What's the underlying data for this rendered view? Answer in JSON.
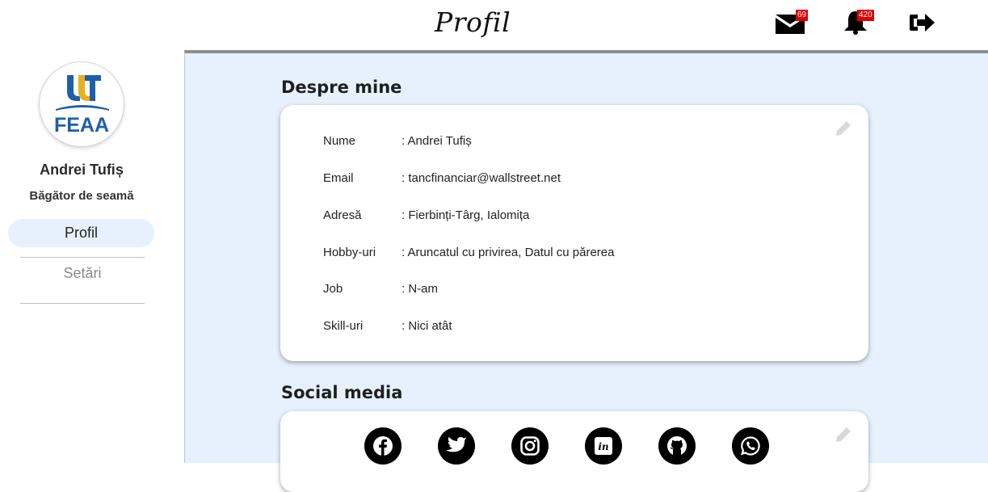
{
  "header": {
    "title": "Profil",
    "messages_count": "69",
    "notifications_count": "420",
    "icons": [
      "envelope-icon",
      "bell-icon",
      "logout-icon"
    ]
  },
  "sidebar": {
    "logo_text": "FEAA",
    "user_name": "Andrei Tufiș",
    "user_role": "Băgător de seamă",
    "nav": [
      {
        "label": "Profil",
        "active": true
      },
      {
        "label": "Setări",
        "active": false
      }
    ]
  },
  "about": {
    "title": "Despre mine",
    "rows": [
      {
        "label": "Nume",
        "value": ": Andrei Tufiș"
      },
      {
        "label": "Email",
        "value": ": tancfinanciar@wallstreet.net"
      },
      {
        "label": "Adresă",
        "value": ": Fierbinți-Târg, Ialomița"
      },
      {
        "label": "Hobby-uri",
        "value": ": Aruncatul cu privirea, Datul cu părerea"
      },
      {
        "label": "Job",
        "value": ": N-am"
      },
      {
        "label": "Skill-uri",
        "value": ": Nici atât"
      }
    ]
  },
  "social": {
    "title": "Social media",
    "networks": [
      "facebook-icon",
      "twitter-icon",
      "instagram-icon",
      "linkedin-icon",
      "github-icon",
      "whatsapp-icon"
    ]
  },
  "colors": {
    "main_bg": "#e6f1fd",
    "active_nav_bg": "#e6f1fd",
    "badge": "#e00000",
    "logo_blue": "#1f5fa8",
    "logo_gold": "#e8b020"
  }
}
